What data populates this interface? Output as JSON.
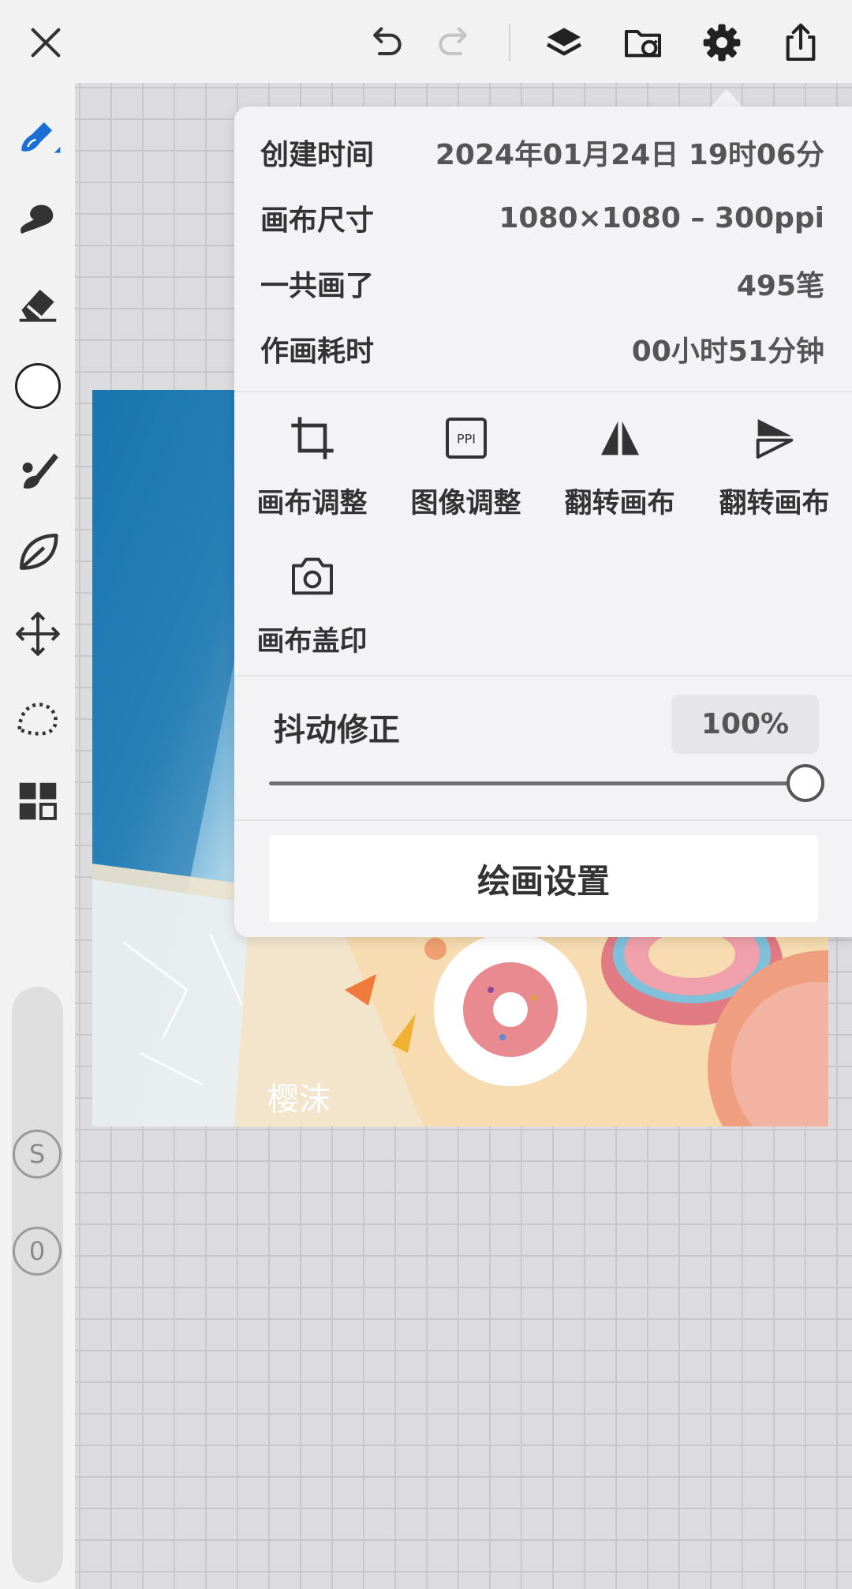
{
  "topbar": {
    "icons": [
      "close-icon",
      "undo-icon",
      "redo-icon",
      "layers-icon",
      "folder-sync-icon",
      "gear-icon",
      "share-icon"
    ]
  },
  "sidebar": {
    "tools": [
      "brush-icon",
      "smudge-icon",
      "eraser-icon",
      "color-swatch",
      "fill-brush-icon",
      "leaf-icon",
      "move-icon",
      "lasso-icon",
      "grid-apps-icon"
    ],
    "current_color": "#ffffff",
    "size_button": "S",
    "opacity_button": "0"
  },
  "artwork": {
    "signature": "樱沫"
  },
  "info": {
    "created_label": "创建时间",
    "created_value": "2024年01月24日 19时06分",
    "size_label": "画布尺寸",
    "size_value": "1080×1080 – 300ppi",
    "strokes_label": "一共画了",
    "strokes_value": "495笔",
    "time_label": "作画耗时",
    "time_value": "00小时51分钟"
  },
  "actions": [
    {
      "label": "画布调整",
      "icon": "crop-icon"
    },
    {
      "label": "图像调整",
      "icon": "ppi-icon",
      "icon_text": "PPI"
    },
    {
      "label": "翻转画布",
      "icon": "flip-horizontal-icon"
    },
    {
      "label": "翻转画布",
      "icon": "flip-vertical-icon"
    },
    {
      "label": "画布盖印",
      "icon": "camera-icon"
    }
  ],
  "jitter": {
    "label": "抖动修正",
    "value": "100%",
    "level": 1.0
  },
  "draw_settings_label": "绘画设置",
  "colors": {
    "accent": "#1a6fd6",
    "panel_bg": "#f3f3f5",
    "toolbar_bg": "#f2f2f2"
  }
}
